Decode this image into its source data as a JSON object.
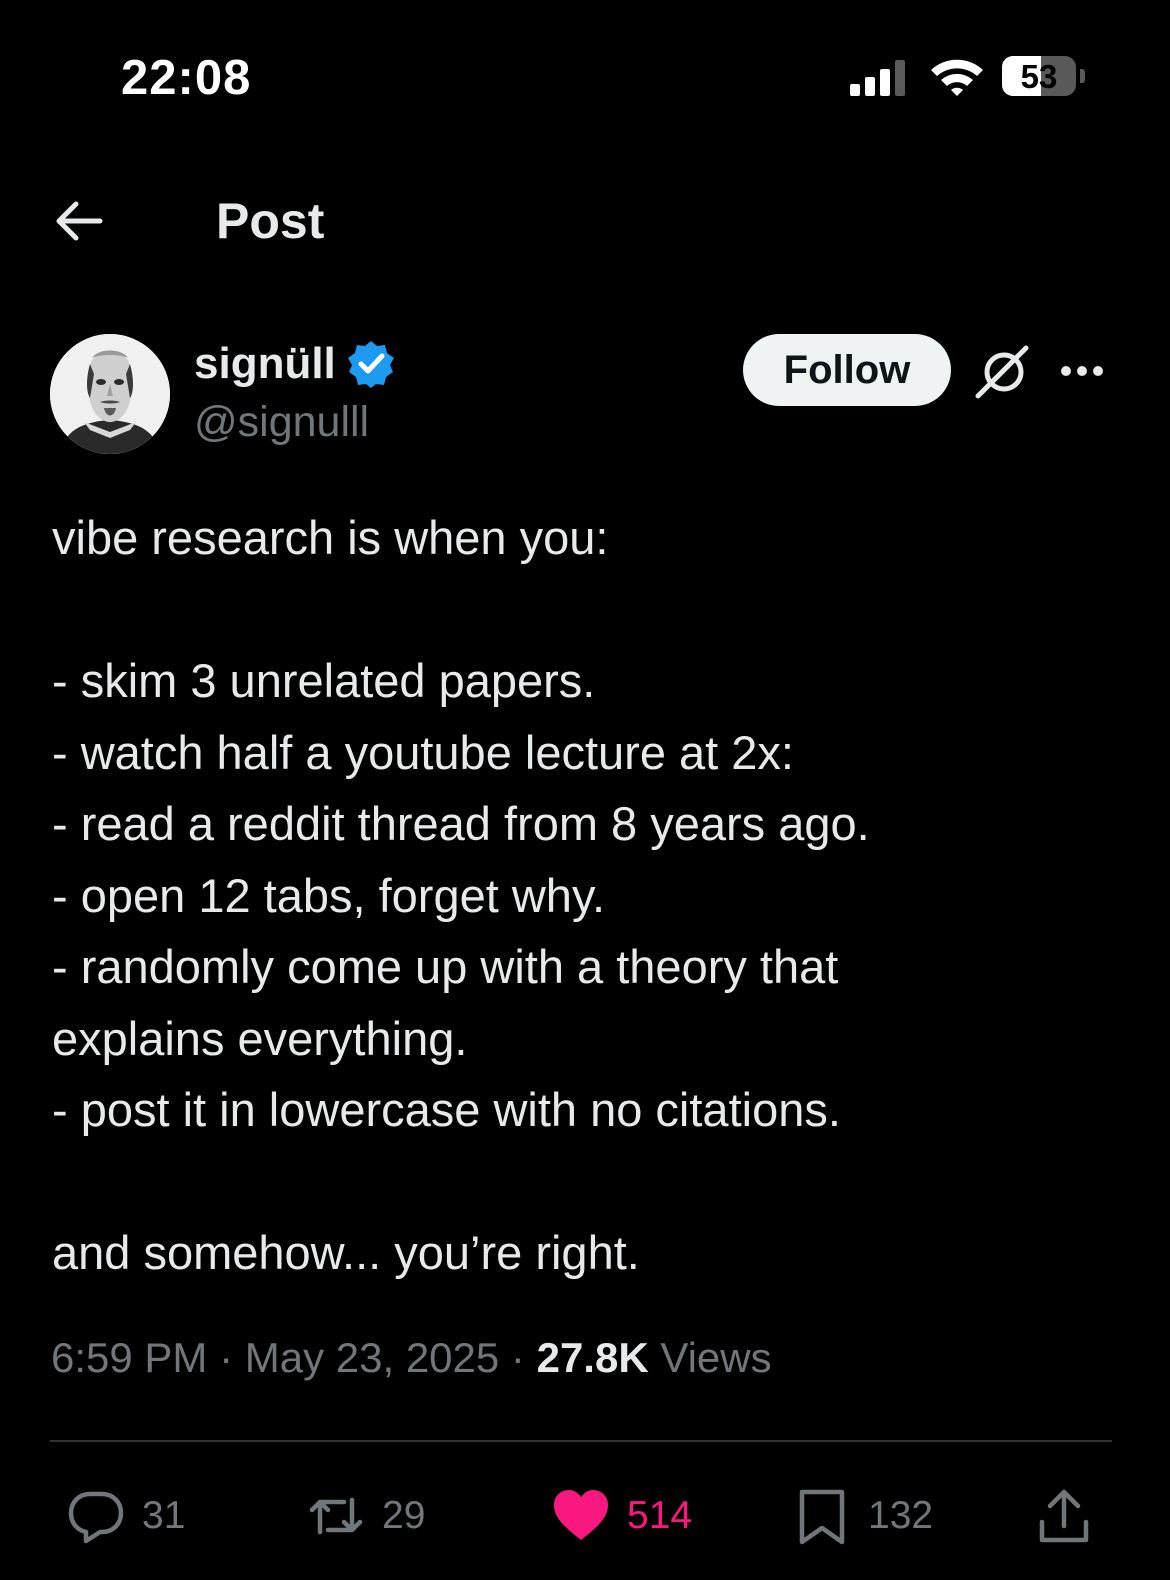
{
  "status_bar": {
    "time": "22:08",
    "battery": "53",
    "battery_level": 0.53
  },
  "header": {
    "title": "Post"
  },
  "author": {
    "display_name": "signüll",
    "handle": "@signulll",
    "verified": true
  },
  "follow_label": "Follow",
  "post": {
    "lines": [
      "vibe research is when you:",
      "",
      "- skim 3 unrelated papers.",
      "- watch half a youtube lecture at 2x:",
      "- read a reddit thread from 8 years ago.",
      "- open 12 tabs, forget why.",
      "- randomly come up with a theory that",
      "explains everything.",
      "- post it in lowercase with no citations.",
      "",
      "and somehow... you’re right."
    ],
    "time": "6:59 PM",
    "date": "May 23, 2025",
    "views_count": "27.8K",
    "views_label": "Views",
    "separator": " · "
  },
  "actions": {
    "replies": "31",
    "reposts": "29",
    "likes": "514",
    "bookmarks": "132"
  },
  "colors": {
    "accent_verified": "#1d9bf0",
    "like": "#f91880",
    "muted": "#71767b"
  }
}
